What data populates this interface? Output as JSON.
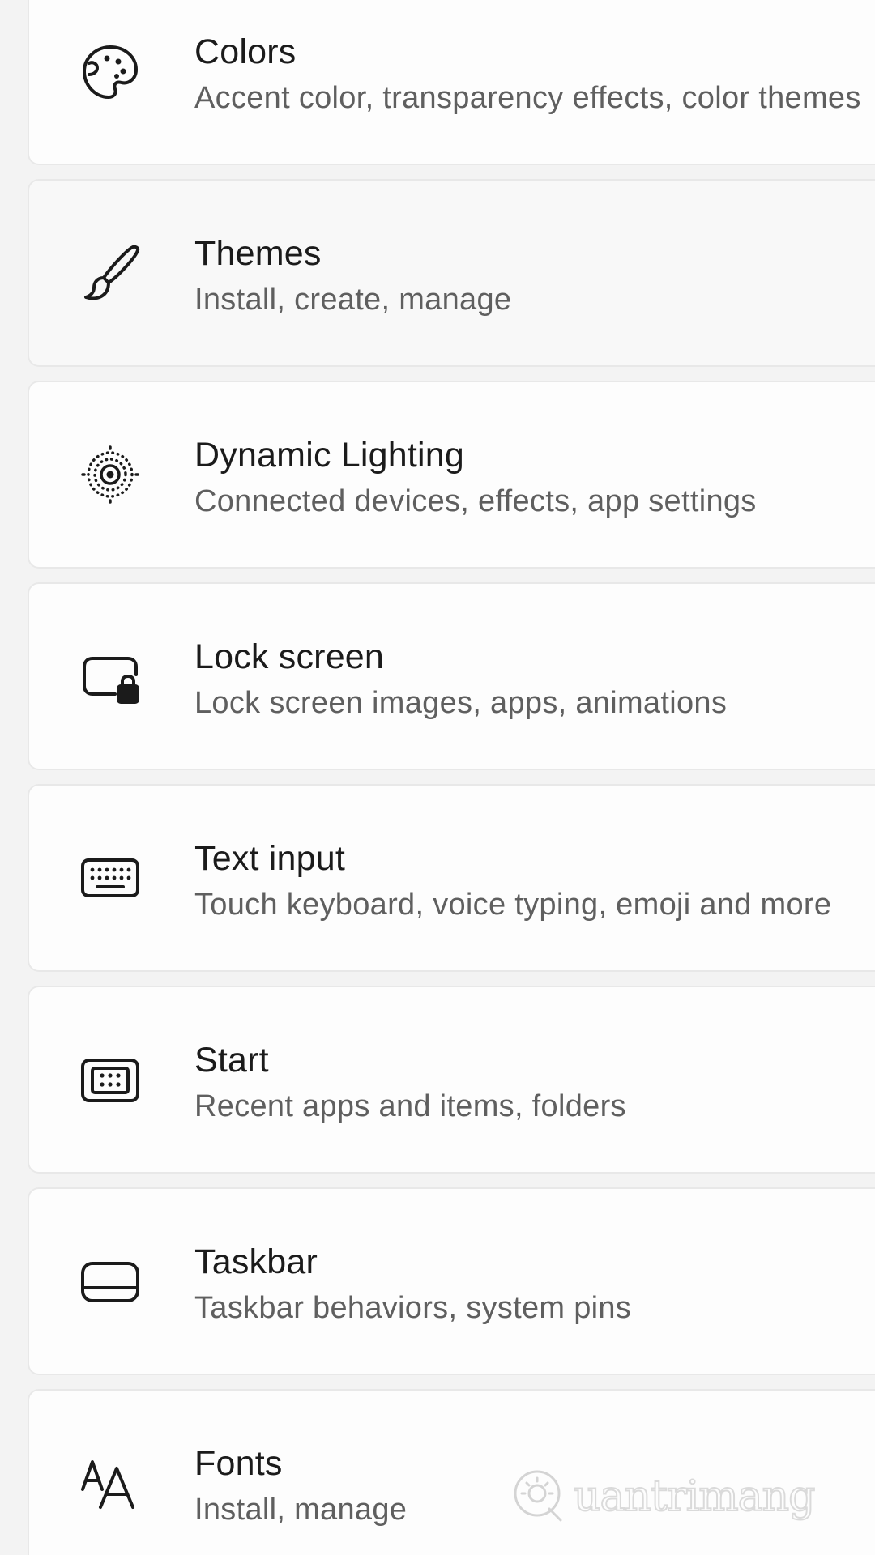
{
  "items": [
    {
      "icon": "palette-icon",
      "title": "Colors",
      "subtitle": "Accent color, transparency effects, color themes"
    },
    {
      "icon": "brush-icon",
      "title": "Themes",
      "subtitle": "Install, create, manage"
    },
    {
      "icon": "dynamic-lighting-icon",
      "title": "Dynamic Lighting",
      "subtitle": "Connected devices, effects, app settings"
    },
    {
      "icon": "lock-screen-icon",
      "title": "Lock screen",
      "subtitle": "Lock screen images, apps, animations"
    },
    {
      "icon": "keyboard-icon",
      "title": "Text input",
      "subtitle": "Touch keyboard, voice typing, emoji and more"
    },
    {
      "icon": "start-icon",
      "title": "Start",
      "subtitle": "Recent apps and items, folders"
    },
    {
      "icon": "taskbar-icon",
      "title": "Taskbar",
      "subtitle": "Taskbar behaviors, system pins"
    },
    {
      "icon": "fonts-icon",
      "title": "Fonts",
      "subtitle": "Install, manage"
    }
  ],
  "watermark": {
    "icon": "watermark-logo-icon",
    "text": "uantrimang"
  },
  "colors": {
    "background": "#f3f3f3",
    "card": "#fdfdfd",
    "card_hover": "#f8f8f8",
    "title": "#1b1b1b",
    "subtitle": "#5f5f5f"
  }
}
